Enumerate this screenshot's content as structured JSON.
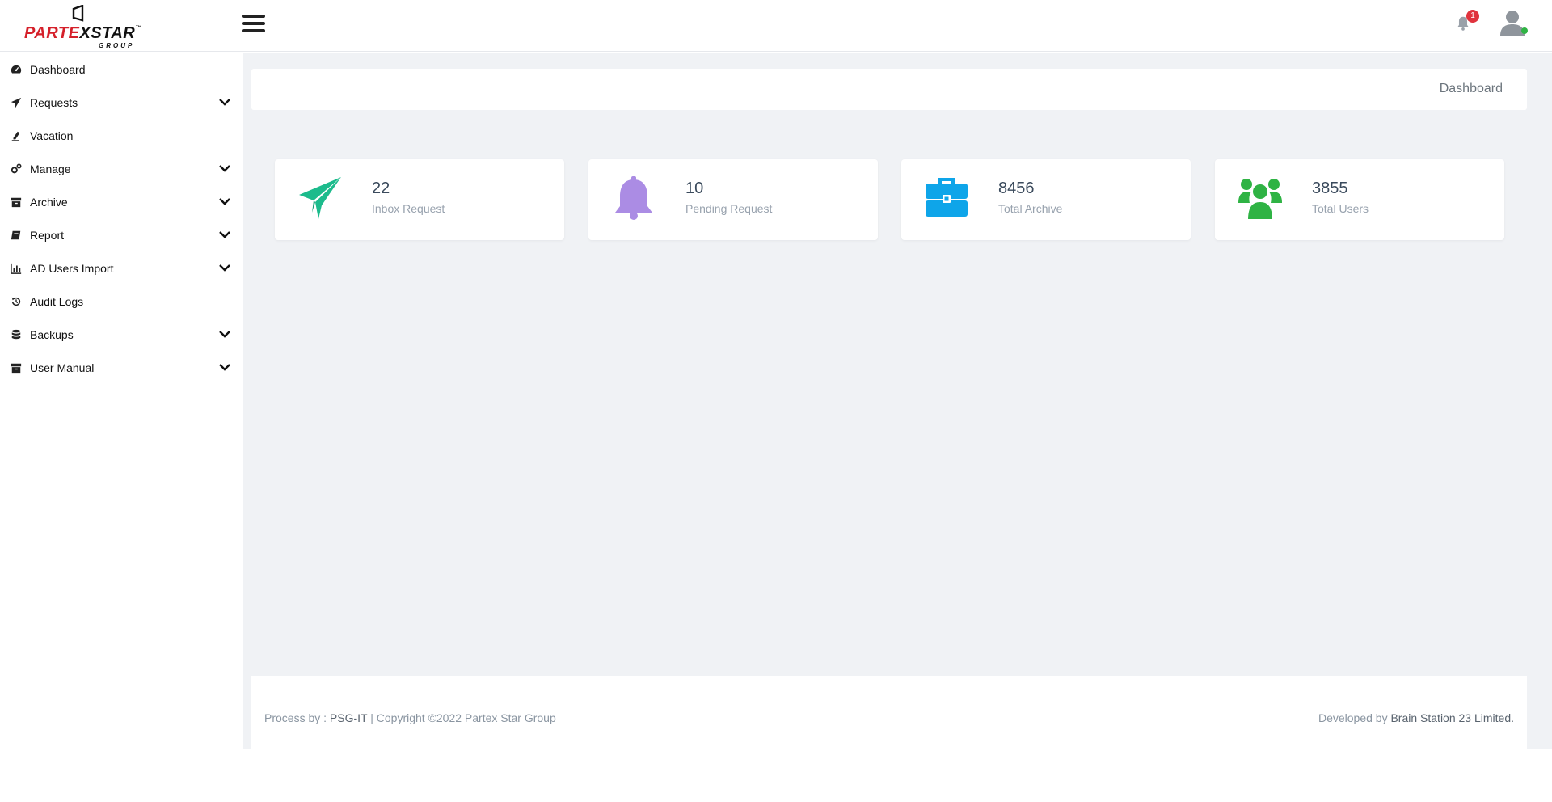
{
  "brand": {
    "logo_part1": "PARTE",
    "logo_x": "X",
    "logo_part2": "STAR",
    "logo_tm": "™",
    "logo_sub": "GROUP"
  },
  "header": {
    "notification_count": "1"
  },
  "sidebar": {
    "items": [
      {
        "label": "Dashboard",
        "icon": "dashboard-icon",
        "has_children": false
      },
      {
        "label": "Requests",
        "icon": "paper-plane-icon",
        "has_children": true
      },
      {
        "label": "Vacation",
        "icon": "pen-icon",
        "has_children": false
      },
      {
        "label": "Manage",
        "icon": "gears-icon",
        "has_children": true
      },
      {
        "label": "Archive",
        "icon": "archive-icon",
        "has_children": true
      },
      {
        "label": "Report",
        "icon": "book-icon",
        "has_children": true
      },
      {
        "label": "AD Users Import",
        "icon": "bar-chart-icon",
        "has_children": true
      },
      {
        "label": "Audit Logs",
        "icon": "history-icon",
        "has_children": false
      },
      {
        "label": "Backups",
        "icon": "database-icon",
        "has_children": true
      },
      {
        "label": "User Manual",
        "icon": "archive-icon",
        "has_children": true
      }
    ]
  },
  "breadcrumb": {
    "current": "Dashboard"
  },
  "cards": [
    {
      "value": "22",
      "label": "Inbox Request",
      "icon": "paper-plane-icon",
      "color": "#1cbb8c"
    },
    {
      "value": "10",
      "label": "Pending Request",
      "icon": "bell-icon",
      "color": "#ab8ce4"
    },
    {
      "value": "8456",
      "label": "Total Archive",
      "icon": "briefcase-icon",
      "color": "#0ea5e9"
    },
    {
      "value": "3855",
      "label": "Total Users",
      "icon": "users-icon",
      "color": "#2fb344"
    }
  ],
  "footer": {
    "left_prefix": "Process by : ",
    "left_org": "PSG-IT",
    "left_suffix": " | Copyright ©2022 Partex Star Group",
    "right_prefix": "Developed by ",
    "right_org": "Brain Station 23 Limited."
  }
}
